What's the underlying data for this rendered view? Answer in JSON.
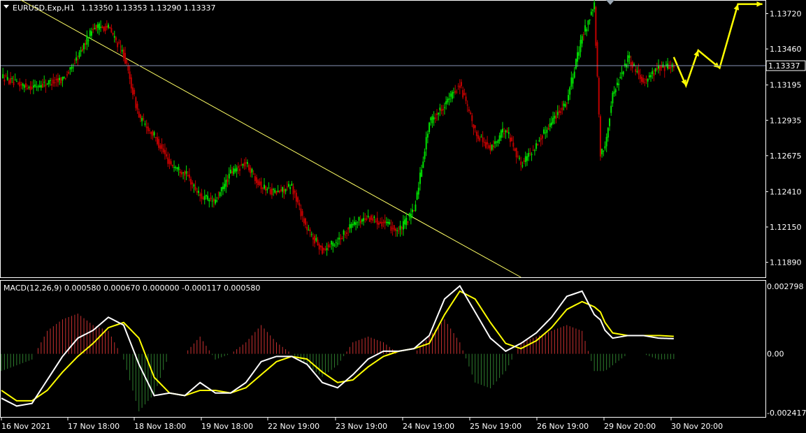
{
  "header": {
    "symbol": "EURUSD.Exp,H1",
    "ohlc": "1.13350 1.13353 1.13290 1.13337"
  },
  "price_panel": {
    "ylim": [
      1.1178,
      1.1381
    ],
    "price_ticks": [
      "1.13720",
      "1.13460",
      "1.13195",
      "1.12935",
      "1.12675",
      "1.12410",
      "1.12150",
      "1.11890"
    ],
    "current_price": "1.13337",
    "current_price_value": 1.13337
  },
  "macd_panel": {
    "label": "MACD(12,26,9) 0.000580 0.000670 0.000000 -0.000117 0.000580",
    "ticks": [
      "0.002798",
      "0.00",
      "-0.002417"
    ]
  },
  "time_axis": {
    "labels": [
      "16 Nov 2021",
      "17 Nov 18:00",
      "18 Nov 18:00",
      "19 Nov 18:00",
      "22 Nov 19:00",
      "23 Nov 19:00",
      "24 Nov 19:00",
      "25 Nov 19:00",
      "26 Nov 19:00",
      "29 Nov 20:00",
      "30 Nov 20:00"
    ]
  },
  "colors": {
    "background": "#000000",
    "bull_candle": "#00e000",
    "bear_candle": "#c00000",
    "trendline": "#ffff66",
    "forecast_arrow": "#ffff00",
    "macd_line": "#ffffff",
    "signal_line": "#ffff00",
    "hist_positive": "#c83030",
    "hist_negative": "#2e7d2e",
    "grid": "#ffffff"
  },
  "chart_data": {
    "type": "line",
    "series": [
      {
        "name": "EURUSD.Exp,H1",
        "x_index": [
          0,
          10,
          20,
          30,
          40,
          45,
          50,
          60,
          70,
          80,
          90,
          100,
          110,
          120,
          130,
          140,
          150,
          160,
          170,
          180,
          190,
          200,
          210,
          220,
          230,
          240,
          250,
          260,
          270,
          280,
          290,
          300,
          310,
          320,
          330,
          340,
          350,
          360,
          370,
          380,
          388,
          392,
          395,
          400,
          410,
          420,
          430,
          440
        ],
        "values": [
          1.1326,
          1.132,
          1.1318,
          1.1321,
          1.1324,
          1.133,
          1.134,
          1.1362,
          1.1362,
          1.1342,
          1.1296,
          1.1282,
          1.1262,
          1.1255,
          1.1238,
          1.1233,
          1.1255,
          1.1262,
          1.1245,
          1.124,
          1.1245,
          1.1213,
          1.1198,
          1.1205,
          1.1218,
          1.1222,
          1.1218,
          1.1212,
          1.1227,
          1.1292,
          1.1305,
          1.132,
          1.1285,
          1.1272,
          1.1288,
          1.1261,
          1.1275,
          1.1293,
          1.1308,
          1.1355,
          1.1378,
          1.1268,
          1.1275,
          1.1312,
          1.134,
          1.1322,
          1.1332,
          1.13337
        ]
      }
    ],
    "macd": {
      "x_index": [
        0,
        10,
        20,
        30,
        40,
        50,
        60,
        70,
        80,
        90,
        100,
        110,
        120,
        130,
        140,
        150,
        160,
        170,
        180,
        190,
        200,
        210,
        220,
        230,
        240,
        250,
        260,
        270,
        280,
        290,
        300,
        310,
        320,
        330,
        340,
        350,
        360,
        370,
        380,
        388,
        392,
        395,
        400,
        410,
        420,
        430,
        440
      ],
      "macd": [
        -0.0017,
        -0.002,
        -0.0019,
        -0.001,
        -0.0001,
        0.0006,
        0.0009,
        0.0014,
        0.0011,
        -0.0004,
        -0.0016,
        -0.0015,
        -0.0016,
        -0.0011,
        -0.0015,
        -0.0015,
        -0.0011,
        -0.0003,
        -0.0001,
        -0.0001,
        -0.0004,
        -0.0011,
        -0.0013,
        -0.0008,
        -0.0002,
        0.0001,
        0.0001,
        0.0002,
        0.0007,
        0.0021,
        0.0026,
        0.0016,
        0.0006,
        0.0001,
        0.0004,
        0.0008,
        0.0014,
        0.0022,
        0.0024,
        0.0015,
        0.0013,
        0.0009,
        0.0006,
        0.0007,
        0.0007,
        0.0006,
        0.00058
      ],
      "signal": [
        -0.0014,
        -0.0018,
        -0.0018,
        -0.0014,
        -0.0007,
        -0.0001,
        0.0004,
        0.001,
        0.0012,
        0.0006,
        -0.0009,
        -0.0015,
        -0.0016,
        -0.0014,
        -0.0014,
        -0.0015,
        -0.0013,
        -0.0008,
        -0.0003,
        -0.0001,
        -0.0002,
        -0.0007,
        -0.0011,
        -0.001,
        -0.0005,
        -0.0001,
        0.0001,
        0.0002,
        0.0004,
        0.0015,
        0.0024,
        0.0021,
        0.0012,
        0.0004,
        0.0002,
        0.0005,
        0.001,
        0.0017,
        0.002,
        0.0018,
        0.0016,
        0.0012,
        0.0008,
        0.0007,
        0.0007,
        0.0007,
        0.00067
      ]
    },
    "forecast": {
      "x_index": [
        440,
        448,
        456,
        470,
        482,
        498
      ],
      "values": [
        1.134,
        1.1319,
        1.1345,
        1.1332,
        1.1379,
        1.1379
      ]
    },
    "trendline": {
      "x_index": [
        0,
        340
      ],
      "values": [
        1.139,
        1.1178
      ]
    }
  }
}
